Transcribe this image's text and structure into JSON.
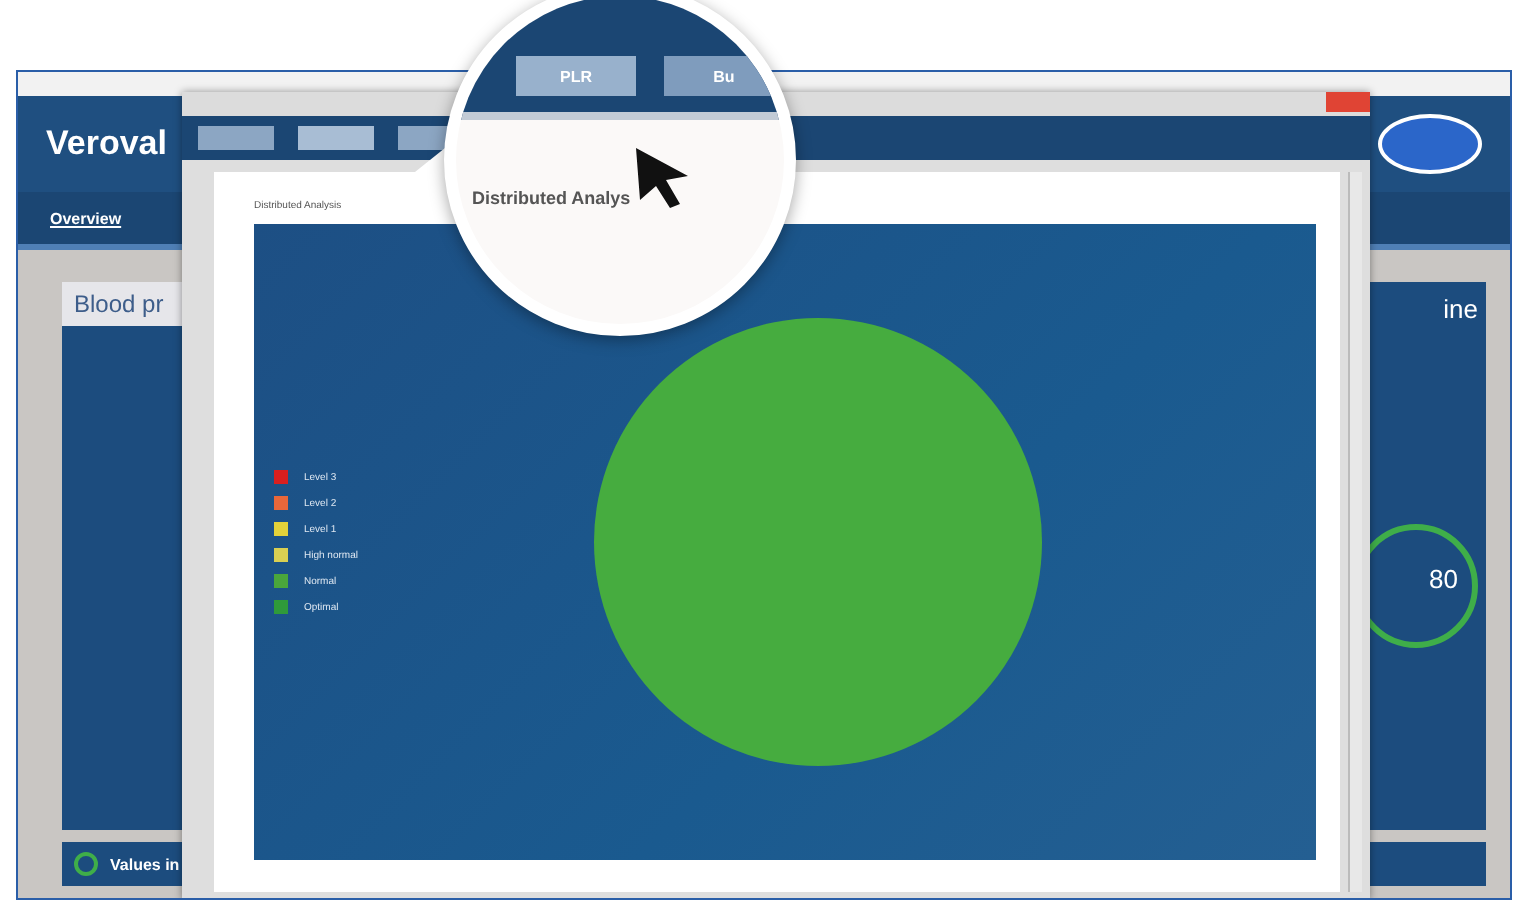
{
  "app": {
    "logo": "Veroval",
    "nav": [
      {
        "label": "Overview",
        "selected": true
      }
    ],
    "left_panel": {
      "title": "Blood pr",
      "footer": "Values in"
    },
    "right_panel": {
      "title": "ine",
      "reading": "80"
    }
  },
  "dialog": {
    "tabs": [
      {
        "selected": false
      },
      {
        "selected": true
      },
      {
        "selected": false
      }
    ],
    "heading": "Distributed Analysis",
    "legend": [
      {
        "label": "Level 3",
        "color": "#d91f1f"
      },
      {
        "label": "Level 2",
        "color": "#e8673a"
      },
      {
        "label": "Level 1",
        "color": "#e3d23a"
      },
      {
        "label": "High normal",
        "color": "#d9cf52"
      },
      {
        "label": "Normal",
        "color": "#4aa63c"
      },
      {
        "label": "Optimal",
        "color": "#2f9a3a"
      }
    ]
  },
  "magnifier": {
    "tabs": [
      {
        "label": "PLR",
        "selected": true
      },
      {
        "label": "Bu",
        "selected": false
      }
    ],
    "heading": "Distributed Analys"
  }
}
